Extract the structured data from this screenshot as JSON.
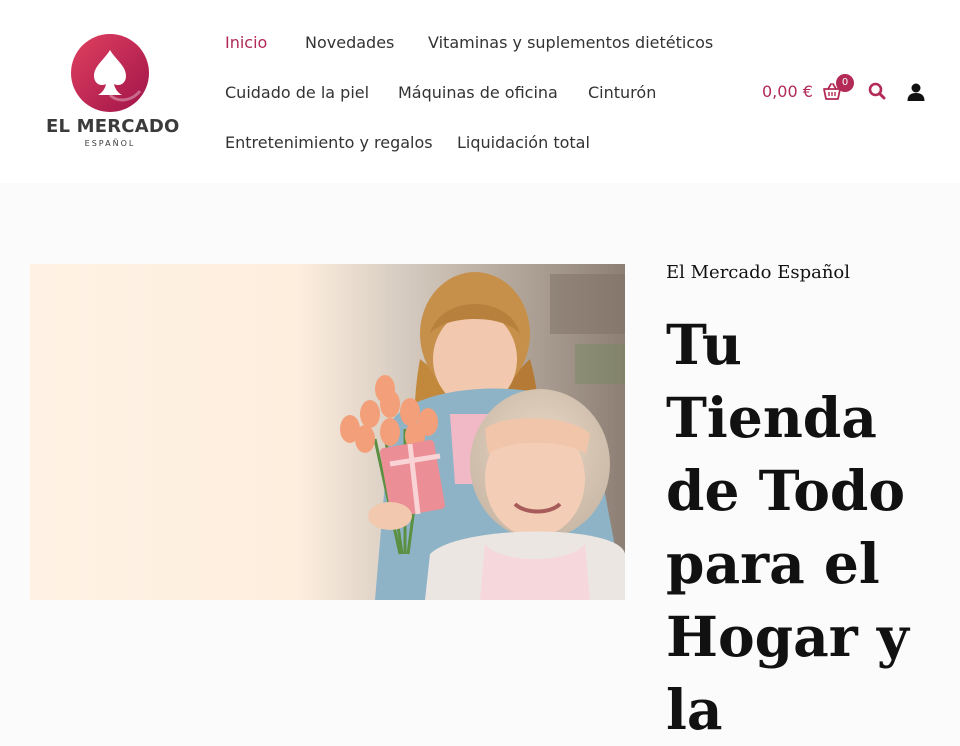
{
  "brand": {
    "name": "EL MERCADO",
    "subtitle": "ESPAÑOL"
  },
  "nav": {
    "items": [
      {
        "label": "Inicio",
        "active": true
      },
      {
        "label": "Novedades"
      },
      {
        "label": "Vitaminas y suplementos dietéticos"
      },
      {
        "label": "Cuidado de la piel"
      },
      {
        "label": "Máquinas de oficina"
      },
      {
        "label": "Cinturón"
      },
      {
        "label": "Entretenimiento y regalos"
      },
      {
        "label": "Liquidación total"
      }
    ]
  },
  "header_actions": {
    "cart_total": "0,00 €",
    "cart_count": "0",
    "icons": [
      "cart-icon",
      "search-icon",
      "user-icon"
    ]
  },
  "hero": {
    "eyebrow": "El Mercado Español",
    "title": "Tu Tienda de Todo para el Hogar y la"
  },
  "colors": {
    "accent": "#b22a55",
    "text": "#111111",
    "background": "#fcfbfb",
    "header_bg": "#ffffff"
  }
}
